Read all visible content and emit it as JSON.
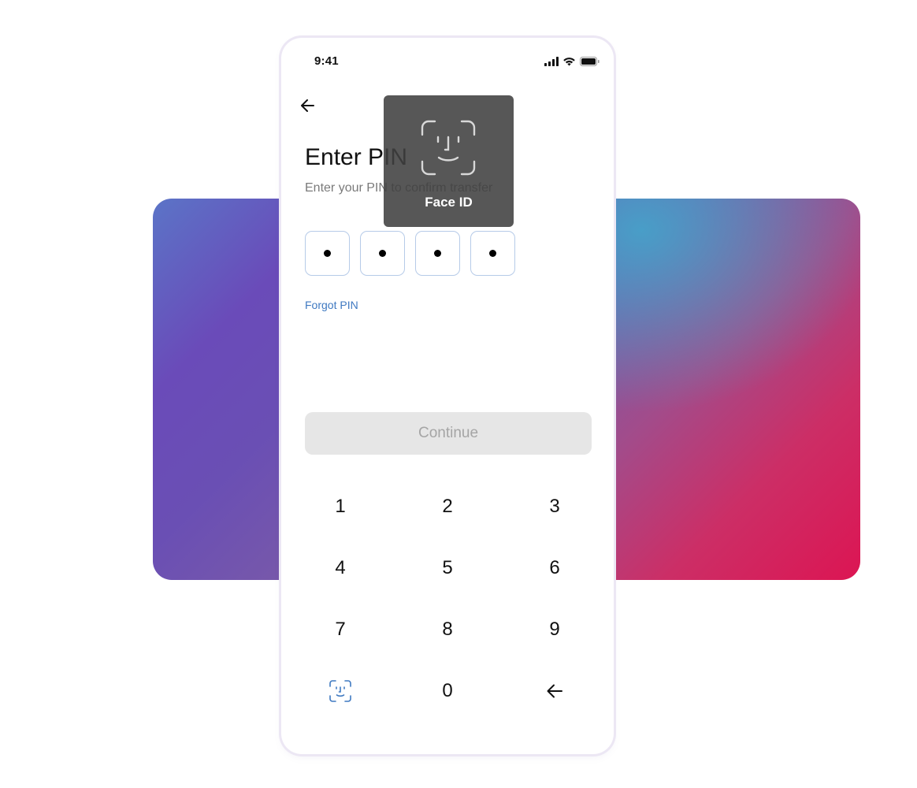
{
  "status_bar": {
    "time": "9:41"
  },
  "header": {
    "title": "Enter PIN",
    "subtitle": "Enter your PIN to confirm transfer"
  },
  "pin": {
    "length": 4,
    "filled": 4,
    "slots": [
      "•",
      "•",
      "•",
      "•"
    ]
  },
  "links": {
    "forgot_pin": "Forgot PIN"
  },
  "actions": {
    "continue_label": "Continue",
    "continue_enabled": false
  },
  "keypad": {
    "keys": [
      "1",
      "2",
      "3",
      "4",
      "5",
      "6",
      "7",
      "8",
      "9"
    ],
    "zero": "0",
    "left_action_icon": "face-id-icon",
    "right_action_icon": "backspace-arrow-icon"
  },
  "faceid_overlay": {
    "label": "Face ID",
    "icon": "face-id-icon"
  },
  "colors": {
    "accent": "#3f79c1",
    "pin_border": "#b6cbe8",
    "button_disabled_bg": "#e6e6e6",
    "button_disabled_text": "#a5a5a5",
    "overlay_bg": "#404040",
    "gradient_start": "#6a4bb9",
    "gradient_mid": "#40aacd",
    "gradient_end": "#dc1553"
  }
}
